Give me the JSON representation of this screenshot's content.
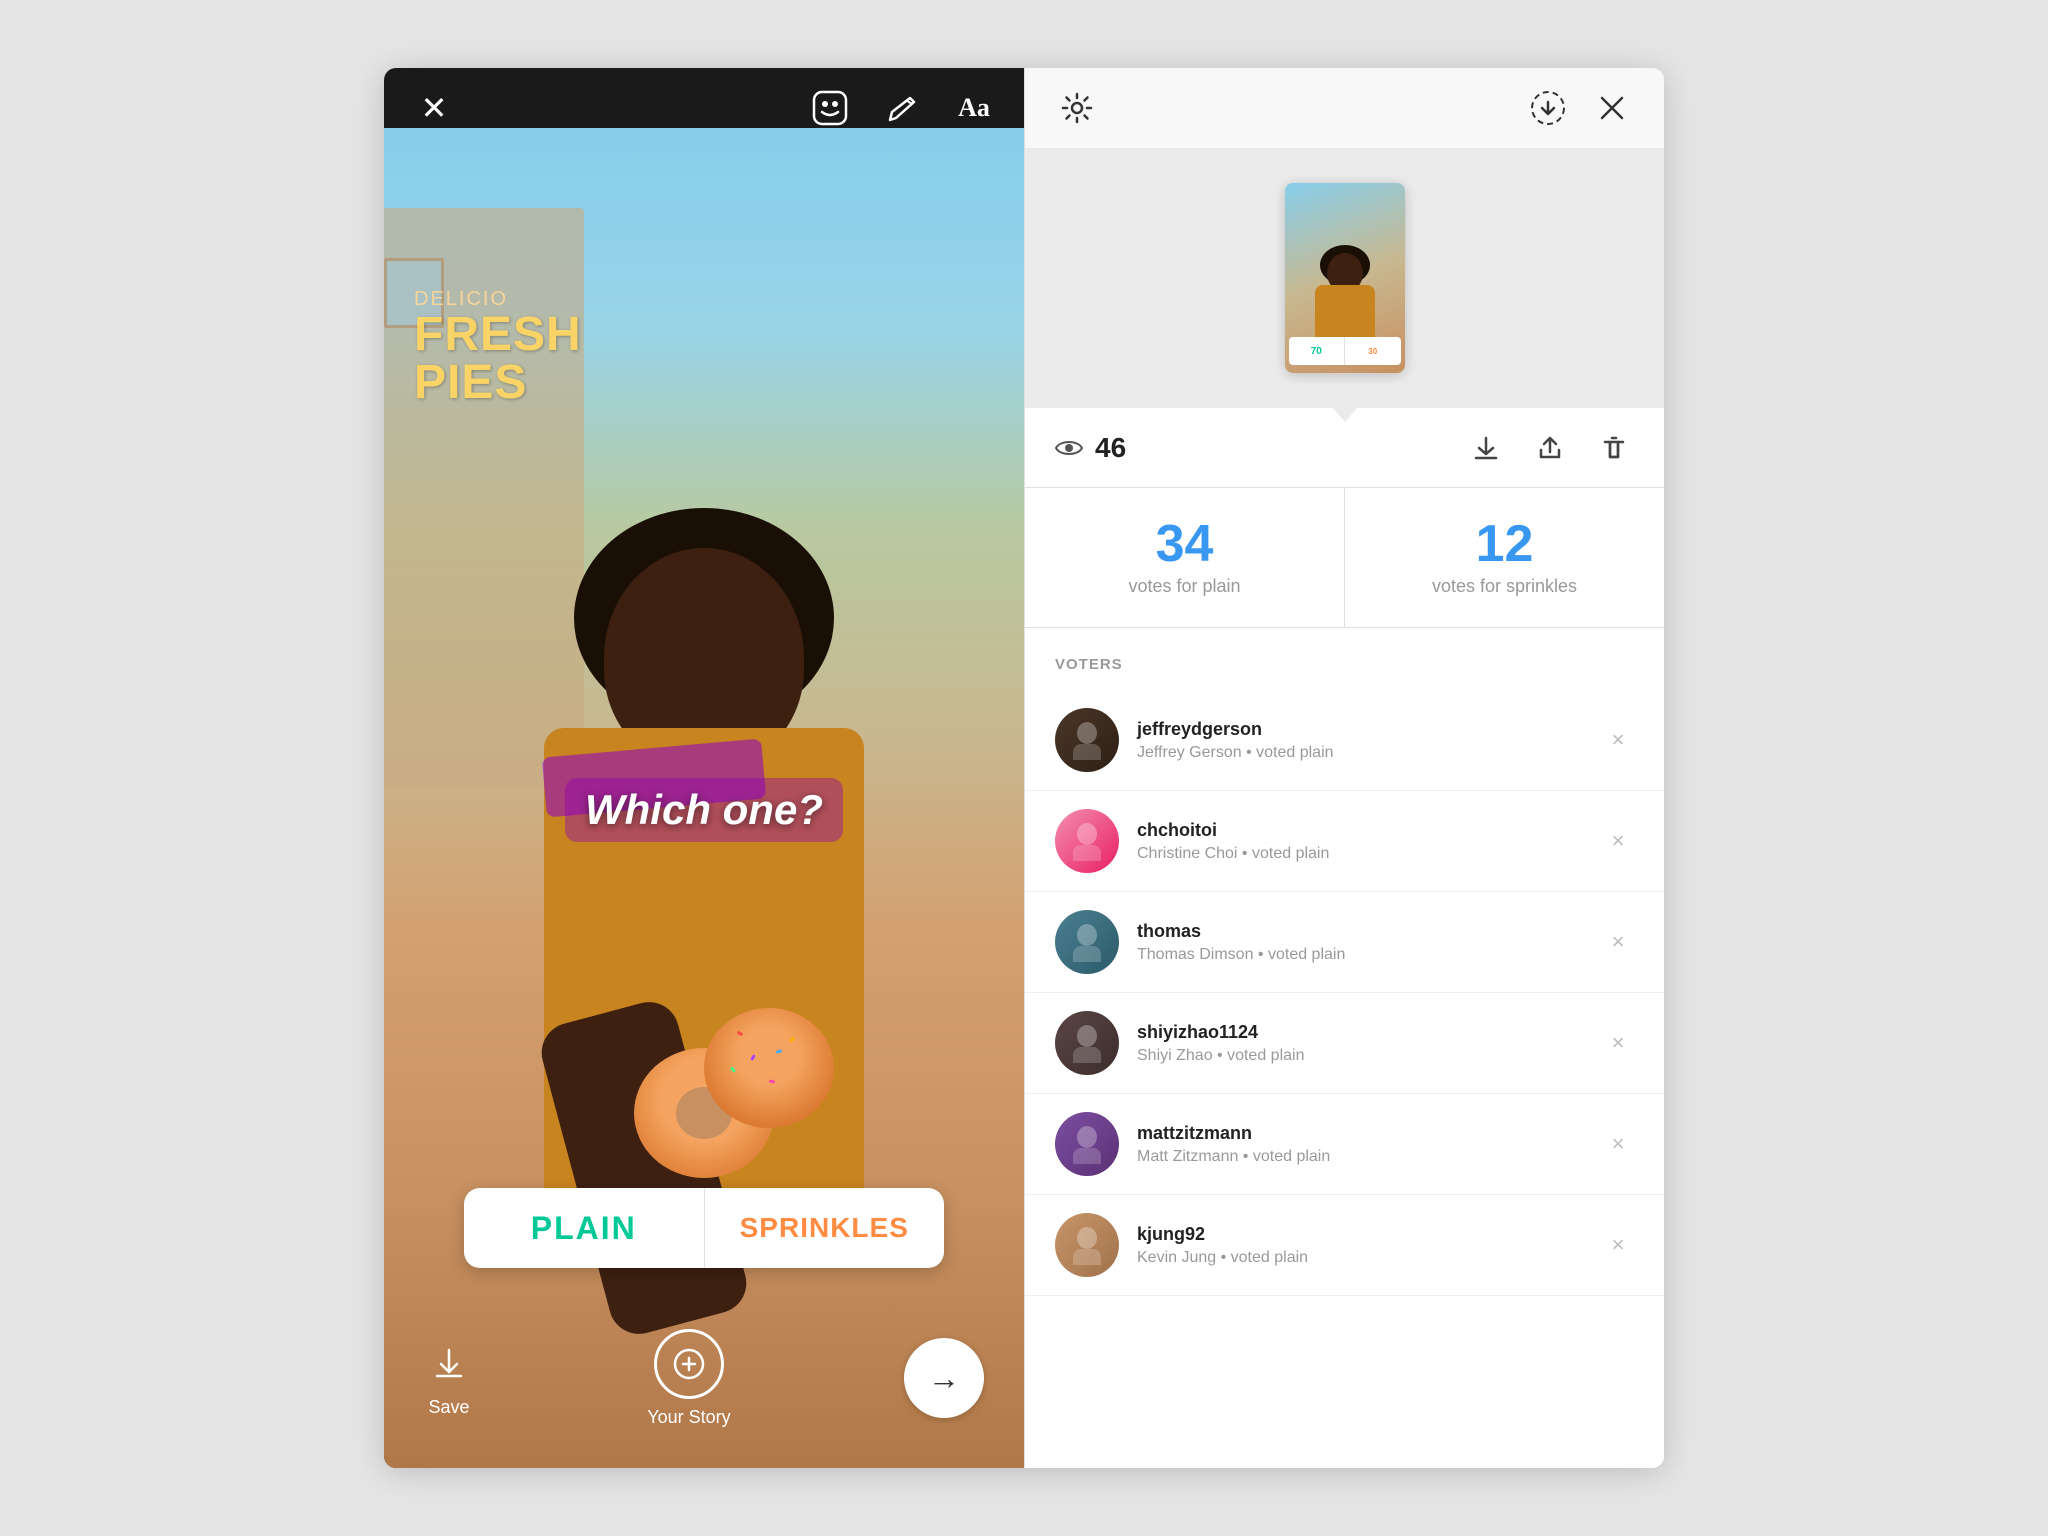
{
  "left": {
    "close_label": "×",
    "story_question": "Which one?",
    "poll": {
      "option1": "PLAIN",
      "option2": "SPRINKLES"
    },
    "bottom_bar": {
      "save_label": "Save",
      "your_story_label": "Your Story"
    },
    "bakery": {
      "line1": "DELICIO",
      "line2": "FRESH",
      "line3": "PIES"
    }
  },
  "right": {
    "views_count": "46",
    "poll_results": {
      "plain_count": "34",
      "plain_label": "votes for plain",
      "sprinkles_count": "12",
      "sprinkles_label": "votes for sprinkles"
    },
    "voters_section_title": "VOTERS",
    "voters": [
      {
        "username": "jeffreydgerson",
        "detail": "Jeffrey Gerson • voted plain",
        "avatar_class": "avatar-dark"
      },
      {
        "username": "chchoitoi",
        "detail": "Christine Choi • voted plain",
        "avatar_class": "avatar-pink"
      },
      {
        "username": "thomas",
        "detail": "Thomas Dimson • voted plain",
        "avatar_class": "avatar-blue"
      },
      {
        "username": "shiyizhao1124",
        "detail": "Shiyi Zhao • voted plain",
        "avatar_class": "avatar-sunglasses"
      },
      {
        "username": "mattzitzmann",
        "detail": "Matt Zitzmann • voted plain",
        "avatar_class": "avatar-purple"
      },
      {
        "username": "kjung92",
        "detail": "Kevin Jung • voted plain",
        "avatar_class": "avatar-tan"
      }
    ],
    "thumbnail_poll": {
      "left_count": "70",
      "right_count": "30"
    }
  }
}
